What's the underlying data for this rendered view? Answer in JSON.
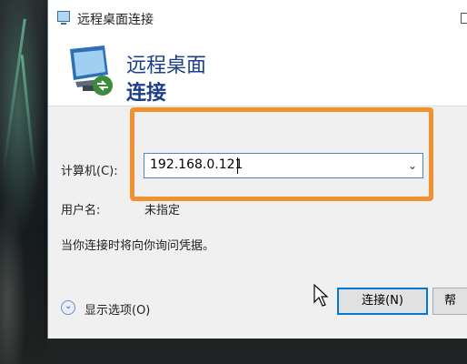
{
  "window": {
    "title": "远程桌面连接"
  },
  "header": {
    "line1": "远程桌面",
    "line2": "连接"
  },
  "form": {
    "computer_label": "计算机(C):",
    "computer_value": "192.168.0.121",
    "username_label": "用户名:",
    "username_value": "未指定",
    "info_text": "当你连接时将向你询问凭据。"
  },
  "footer": {
    "show_options_label": "显示选项(O)",
    "connect_label": "连接(N)",
    "help_label": "帮"
  },
  "colors": {
    "accent": "#0078d7",
    "highlight": "#f2922e",
    "header_text": "#1d3f8a"
  }
}
